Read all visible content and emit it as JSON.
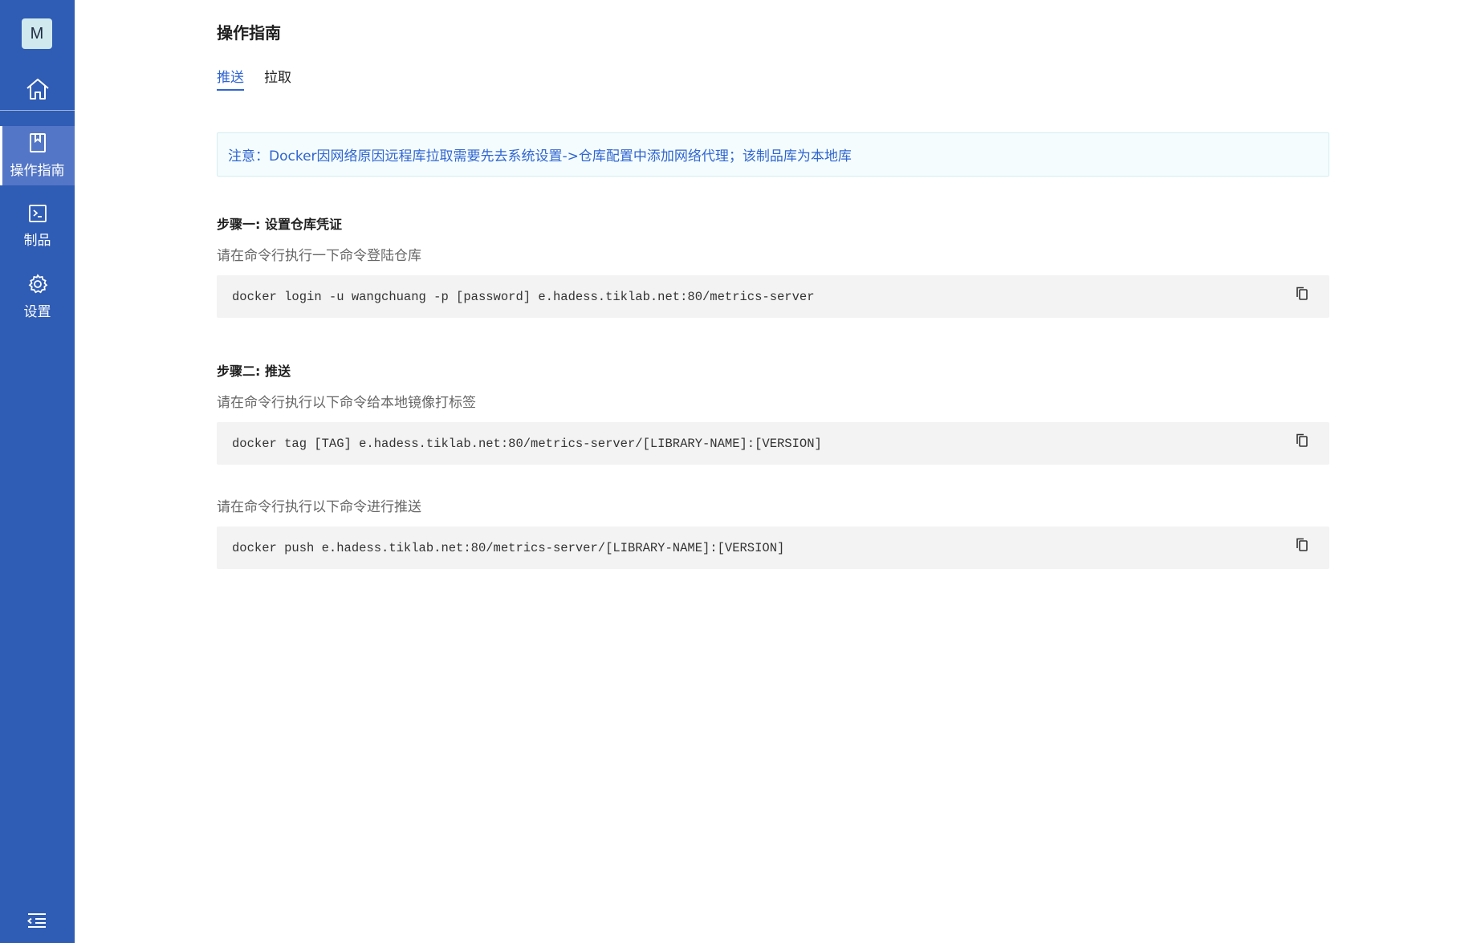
{
  "sidebar": {
    "avatar_letter": "M",
    "home_icon": "home-icon",
    "items": [
      {
        "label": "操作指南",
        "icon": "book-icon",
        "active": true
      },
      {
        "label": "制品",
        "icon": "terminal-icon",
        "active": false
      },
      {
        "label": "设置",
        "icon": "gear-icon",
        "active": false
      }
    ],
    "collapse_icon": "menu-collapse-icon"
  },
  "main": {
    "title": "操作指南",
    "tabs": [
      {
        "label": "推送",
        "active": true
      },
      {
        "label": "拉取",
        "active": false
      }
    ],
    "notice": "注意：Docker因网络原因远程库拉取需要先去系统设置->仓库配置中添加网络代理；该制品库为本地库",
    "steps": [
      {
        "title": "步骤一: 设置仓库凭证",
        "blocks": [
          {
            "desc": "请在命令行执行一下命令登陆仓库",
            "code": "docker login -u wangchuang -p [password] e.hadess.tiklab.net:80/metrics-server"
          }
        ]
      },
      {
        "title": "步骤二: 推送",
        "blocks": [
          {
            "desc": "请在命令行执行以下命令给本地镜像打标签",
            "code": "docker tag [TAG] e.hadess.tiklab.net:80/metrics-server/[LIBRARY-NAME]:[VERSION]"
          },
          {
            "desc": "请在命令行执行以下命令进行推送",
            "code": "docker push e.hadess.tiklab.net:80/metrics-server/[LIBRARY-NAME]:[VERSION]"
          }
        ]
      }
    ],
    "copy_icon": "copy-icon"
  },
  "colors": {
    "sidebar_bg": "#2f5cb4",
    "sidebar_active": "#5376c6",
    "accent": "#2f65d1",
    "code_bg": "#f3f3f3"
  }
}
